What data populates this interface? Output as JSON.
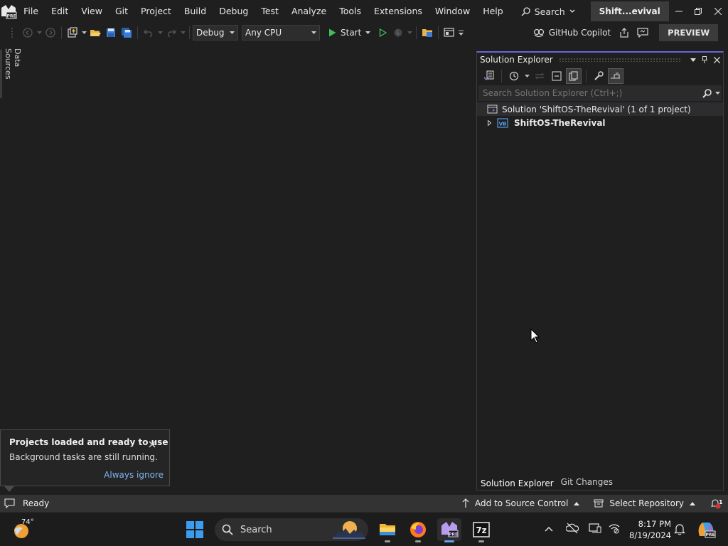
{
  "menu": {
    "items": [
      "File",
      "Edit",
      "View",
      "Git",
      "Project",
      "Build",
      "Debug",
      "Test",
      "Analyze",
      "Tools",
      "Extensions",
      "Window",
      "Help"
    ],
    "search_label": "Search",
    "solution_badge": "Shift...evival",
    "logo_badge": "PRE"
  },
  "toolbar": {
    "config": "Debug",
    "platform": "Any CPU",
    "start_label": "Start",
    "copilot_label": "GitHub Copilot",
    "preview_label": "PREVIEW"
  },
  "left_tab": {
    "label": "Data Sources"
  },
  "solution_explorer": {
    "title": "Solution Explorer",
    "search_placeholder": "Search Solution Explorer (Ctrl+;)",
    "solution_label": "Solution 'ShiftOS-TheRevival' (1 of 1 project)",
    "project_label": "ShiftOS-TheRevival",
    "project_icon_text": "VB",
    "tabs": [
      "Solution Explorer",
      "Git Changes"
    ]
  },
  "toast": {
    "title": "Projects loaded and ready to use",
    "body": "Background tasks are still running.",
    "action": "Always ignore"
  },
  "statusbar": {
    "ready": "Ready",
    "source_control": "Add to Source Control",
    "repository": "Select Repository",
    "notifications_count": "1"
  },
  "taskbar": {
    "weather_temp": "74°",
    "search_label": "Search",
    "time": "8:17 PM",
    "date": "8/19/2024",
    "sevenzip_label": "7z"
  },
  "colors": {
    "accent": "#6b62d6",
    "link": "#7fb3f0",
    "play_green": "#3fbf5a"
  }
}
